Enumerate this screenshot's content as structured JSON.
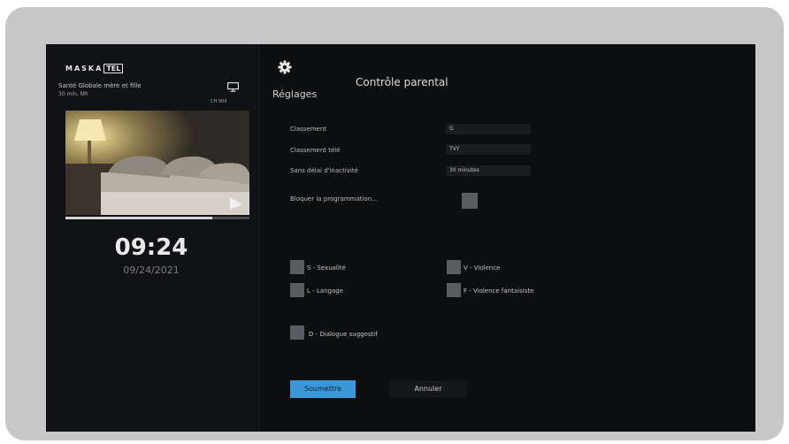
{
  "branding": {
    "logo_prefix": "MASKA",
    "logo_suffix": "TEL"
  },
  "now_playing": {
    "title": "Santé Globale mère et fille",
    "meta": "30 min, NR",
    "channel": "CH 909",
    "progress_fraction": 0.8
  },
  "clock": {
    "time": "09:24",
    "date": "09/24/2021"
  },
  "header": {
    "settings_label": "Réglages",
    "page_title": "Contrôle parental"
  },
  "settings_rows": [
    {
      "label": "Classement",
      "value": "G"
    },
    {
      "label": "Classement télé",
      "value": "TVY"
    },
    {
      "label": "Sans délai d'inactivité",
      "value": "30 minutes"
    },
    {
      "label": "Bloquer la programmation...",
      "value": ""
    }
  ],
  "content_checkboxes": [
    {
      "label": "S - Sexualité"
    },
    {
      "label": "V - Violence"
    },
    {
      "label": "L - Langage"
    },
    {
      "label": "F - Violence fantaisiste"
    },
    {
      "label": "D - Dialogue suggestif"
    }
  ],
  "buttons": {
    "submit": "Soumettre",
    "cancel": "Annuler"
  },
  "colors": {
    "accent": "#3c97d8",
    "background": "#0d0e10",
    "frame": "#c7c7c7"
  },
  "icons": {
    "tv": "tv-icon",
    "settings": "gear-icon"
  }
}
